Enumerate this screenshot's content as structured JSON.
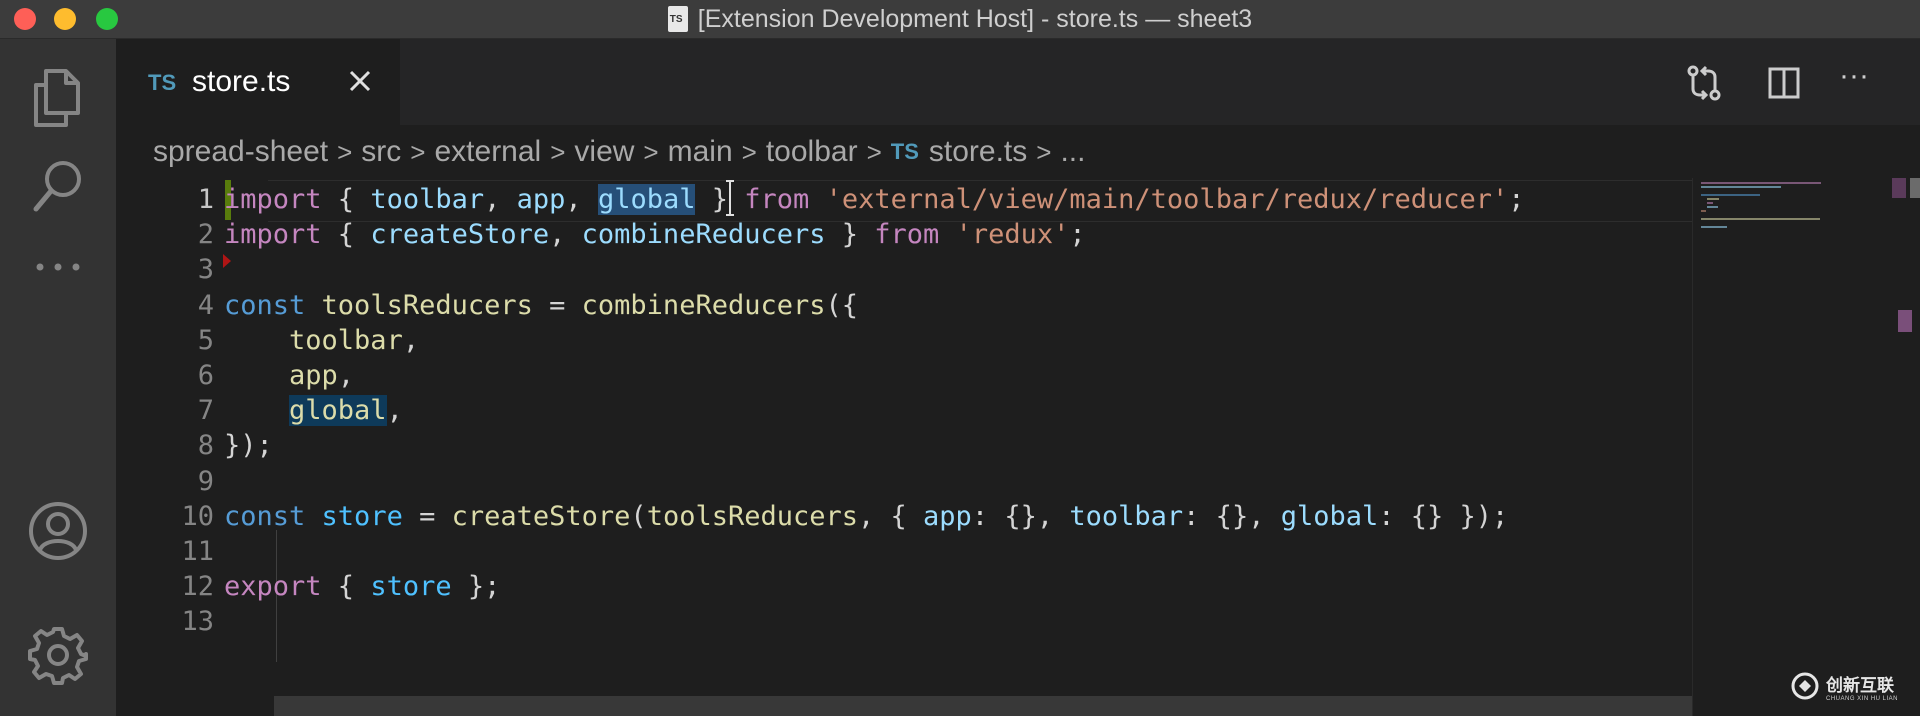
{
  "window": {
    "title": "[Extension Development Host] - store.ts — sheet3",
    "file_icon_badge": "TS"
  },
  "activity_bar": {
    "items": [
      {
        "name": "explorer",
        "icon": "files-icon"
      },
      {
        "name": "search",
        "icon": "search-icon"
      },
      {
        "name": "more",
        "icon": "ellipsis-icon"
      },
      {
        "name": "accounts",
        "icon": "account-icon"
      },
      {
        "name": "settings",
        "icon": "gear-icon"
      }
    ]
  },
  "tab": {
    "badge": "TS",
    "label": "store.ts"
  },
  "tab_actions": {
    "more_label": "···"
  },
  "breadcrumbs": {
    "items": [
      "spread-sheet",
      "src",
      "external",
      "view",
      "main",
      "toolbar"
    ],
    "file_badge": "TS",
    "file": "store.ts",
    "trailing": "...",
    "separator": ">"
  },
  "editor": {
    "line_numbers": [
      "1",
      "2",
      "3",
      "4",
      "5",
      "6",
      "7",
      "8",
      "9",
      "10",
      "11",
      "12",
      "13"
    ],
    "current_line": "1",
    "lines": [
      "import { toolbar, app, global } from 'external/view/main/toolbar/redux/reducer';",
      "import { createStore, combineReducers } from 'redux';",
      "",
      "const toolsReducers = combineReducers({",
      "    toolbar,",
      "    app,",
      "    global,",
      "});",
      "",
      "const store = createStore(toolsReducers, { app: {}, toolbar: {}, global: {} });",
      "",
      "export { store };",
      ""
    ]
  },
  "watermark": {
    "text": "创新互联",
    "subtext": "CHUANG XIN HU LIAN"
  },
  "colors": {
    "keyword": "#c586c0",
    "storage": "#569cd6",
    "variable": "#9cdcfe",
    "function": "#dcdcaa",
    "string": "#ce9178",
    "selection": "#264f78",
    "git_added": "#587c0c"
  }
}
